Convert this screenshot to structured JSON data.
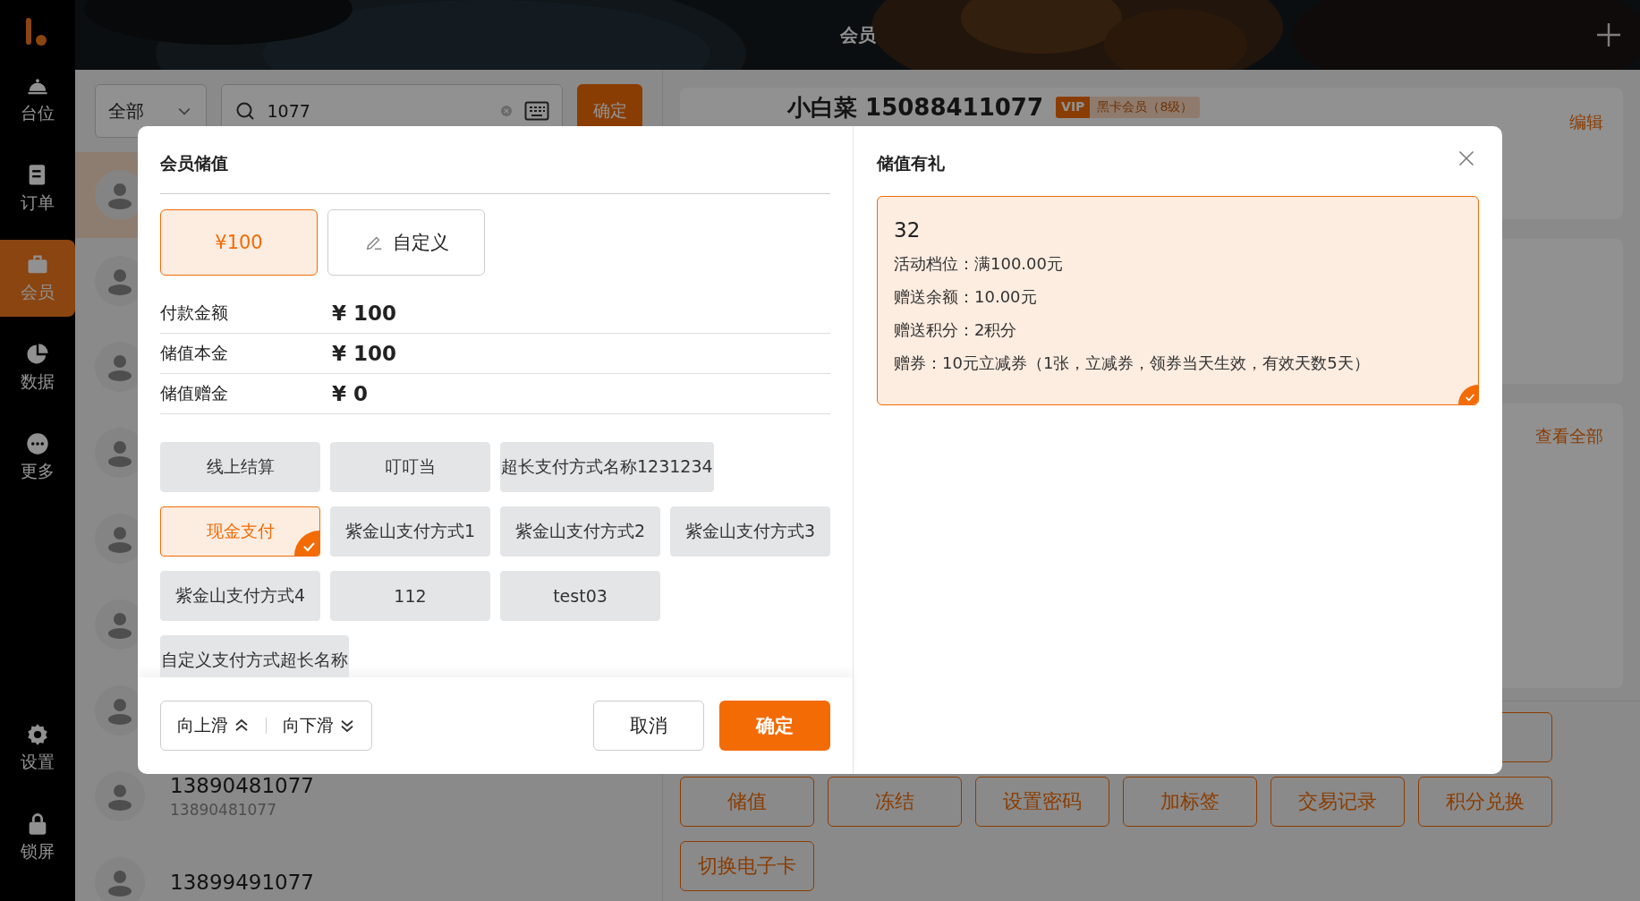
{
  "sidebar": {
    "items": [
      {
        "label": "台位",
        "selected": false
      },
      {
        "label": "订单",
        "selected": false
      },
      {
        "label": "会员",
        "selected": true
      },
      {
        "label": "数据",
        "selected": false
      },
      {
        "label": "更多",
        "selected": false
      }
    ],
    "bottom_items": [
      {
        "label": "设置"
      },
      {
        "label": "锁屏"
      }
    ]
  },
  "header": {
    "title": "会员"
  },
  "filter": {
    "category": "全部",
    "search_value": "1077",
    "confirm": "确定"
  },
  "members": [
    {
      "selected": true
    },
    {
      "selected": false
    },
    {
      "selected": false
    },
    {
      "selected": false
    },
    {
      "selected": false
    },
    {
      "selected": false
    },
    {
      "selected": false
    },
    {
      "name": "13890481077",
      "phone": "13890481077",
      "selected": false
    },
    {
      "name": "13899491077",
      "selected": false
    }
  ],
  "member_card": {
    "name": "小白菜 15088411077",
    "badge": "VIP",
    "level": "黑卡会员（8级）",
    "edit": "编辑"
  },
  "coupons": {
    "view_all": "查看全部"
  },
  "actions": [
    "储值",
    "冻结",
    "设置密码",
    "加标签",
    "交易记录",
    "积分兑换"
  ],
  "extra_actions": [
    "切换电子卡"
  ],
  "dialog": {
    "title": "会员储值",
    "amounts": [
      {
        "label": "¥100",
        "kind": "preset",
        "selected": true
      },
      {
        "label": "自定义",
        "kind": "custom",
        "selected": false
      }
    ],
    "details": [
      {
        "label": "付款金额",
        "value": "¥ 100"
      },
      {
        "label": "储值本金",
        "value": "¥ 100"
      },
      {
        "label": "储值赠金",
        "value": "¥ 0"
      }
    ],
    "payment_methods": [
      {
        "label": "线上结算",
        "selected": false
      },
      {
        "label": "叮叮当",
        "selected": false
      },
      {
        "label": "超长支付方式名称1231234",
        "selected": false
      },
      {
        "label": "现金支付",
        "selected": true
      },
      {
        "label": "紫金山支付方式1",
        "selected": false
      },
      {
        "label": "紫金山支付方式2",
        "selected": false
      },
      {
        "label": "紫金山支付方式3",
        "selected": false
      },
      {
        "label": "紫金山支付方式4",
        "selected": false
      },
      {
        "label": "112",
        "selected": false
      },
      {
        "label": "test03",
        "selected": false
      },
      {
        "label": "自定义支付方式超长名称",
        "selected": false
      }
    ],
    "scroll_up": "向上滑",
    "scroll_down": "向下滑",
    "cancel": "取消",
    "confirm": "确定",
    "gift_panel": {
      "title": "储值有礼",
      "gifts": [
        {
          "amount": "32",
          "lines": [
            "活动档位：满100.00元",
            "赠送余额：10.00元",
            "赠送积分：2积分",
            "赠券：10元立减券（1张，立减券，领券当天生效，有效天数5天）"
          ],
          "selected": true
        }
      ]
    }
  }
}
